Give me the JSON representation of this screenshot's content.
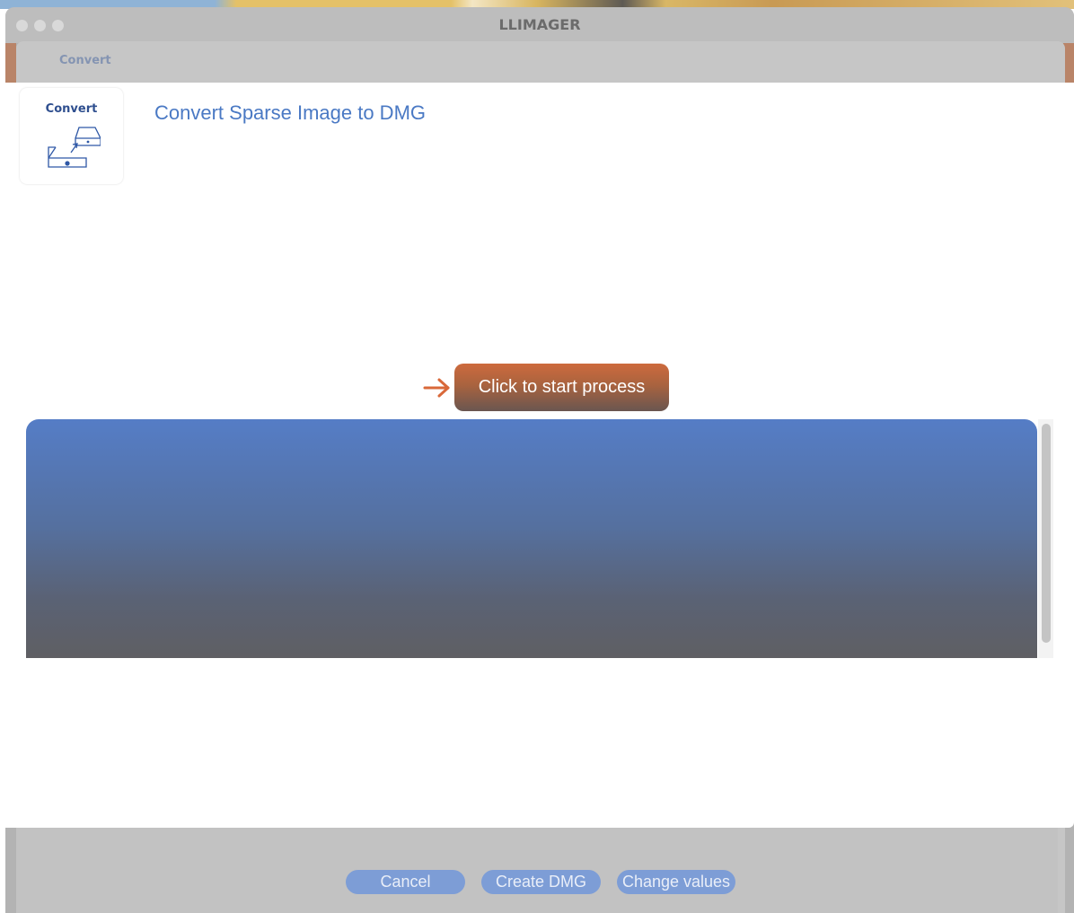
{
  "window": {
    "title": "LLIMAGER"
  },
  "tab": {
    "label": "Convert"
  },
  "icon_card": {
    "label": "Convert",
    "icon": "drive-convert-icon"
  },
  "main": {
    "heading": "Convert Sparse Image to DMG",
    "start_button_label": "Click to start process"
  },
  "footer": {
    "buttons": [
      {
        "label": "Cancel"
      },
      {
        "label": "Create DMG"
      },
      {
        "label": "Change values"
      }
    ]
  },
  "colors": {
    "accent_blue": "#4a79c4",
    "start_button": "#cd6a3d",
    "footer_button": "#7d9dd6"
  }
}
